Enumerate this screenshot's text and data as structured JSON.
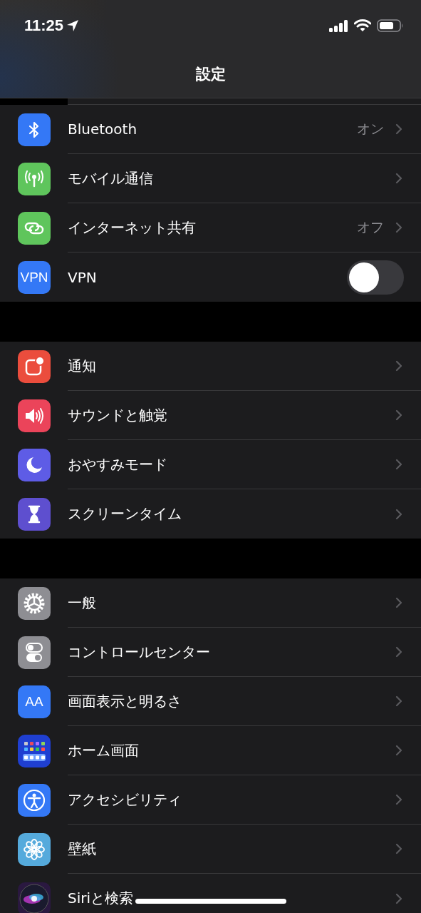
{
  "status_bar": {
    "time": "11:25"
  },
  "title": "設定",
  "groups": [
    {
      "rows": [
        {
          "kind": "bluetooth",
          "color": "#3478f6",
          "label": "Bluetooth",
          "value": "オン"
        },
        {
          "kind": "antenna",
          "color": "#5fc55c",
          "label": "モバイル通信"
        },
        {
          "kind": "link",
          "color": "#5fc55c",
          "label": "インターネット共有",
          "value": "オフ"
        },
        {
          "kind": "vpn",
          "icon_text": "VPN",
          "color": "#3478f6",
          "label": "VPN",
          "on": false
        }
      ]
    },
    {
      "rows": [
        {
          "kind": "notification",
          "color": "#eb4d3d",
          "label": "通知"
        },
        {
          "kind": "speaker",
          "color": "#eb445a",
          "label": "サウンドと触覚"
        },
        {
          "kind": "moon",
          "color": "#5e5ce6",
          "label": "おやすみモード"
        },
        {
          "kind": "hourglass",
          "color": "#5e4fcf",
          "label": "スクリーンタイム"
        }
      ]
    },
    {
      "rows": [
        {
          "kind": "gear",
          "color": "#8e8e93",
          "label": "一般"
        },
        {
          "kind": "switches",
          "color": "#8e8e93",
          "label": "コントロールセンター"
        },
        {
          "kind": "letters",
          "icon_text": "AA",
          "color": "#3478f6",
          "label": "画面表示と明るさ"
        },
        {
          "kind": "grid",
          "color": "#1f3fd1",
          "label": "ホーム画面"
        },
        {
          "kind": "person",
          "color": "#3478f6",
          "label": "アクセシビリティ"
        },
        {
          "kind": "flower",
          "color": "#55aadc",
          "label": "壁紙"
        },
        {
          "kind": "orb",
          "color": "#2a1840",
          "label": "Siriと検索"
        }
      ]
    }
  ]
}
